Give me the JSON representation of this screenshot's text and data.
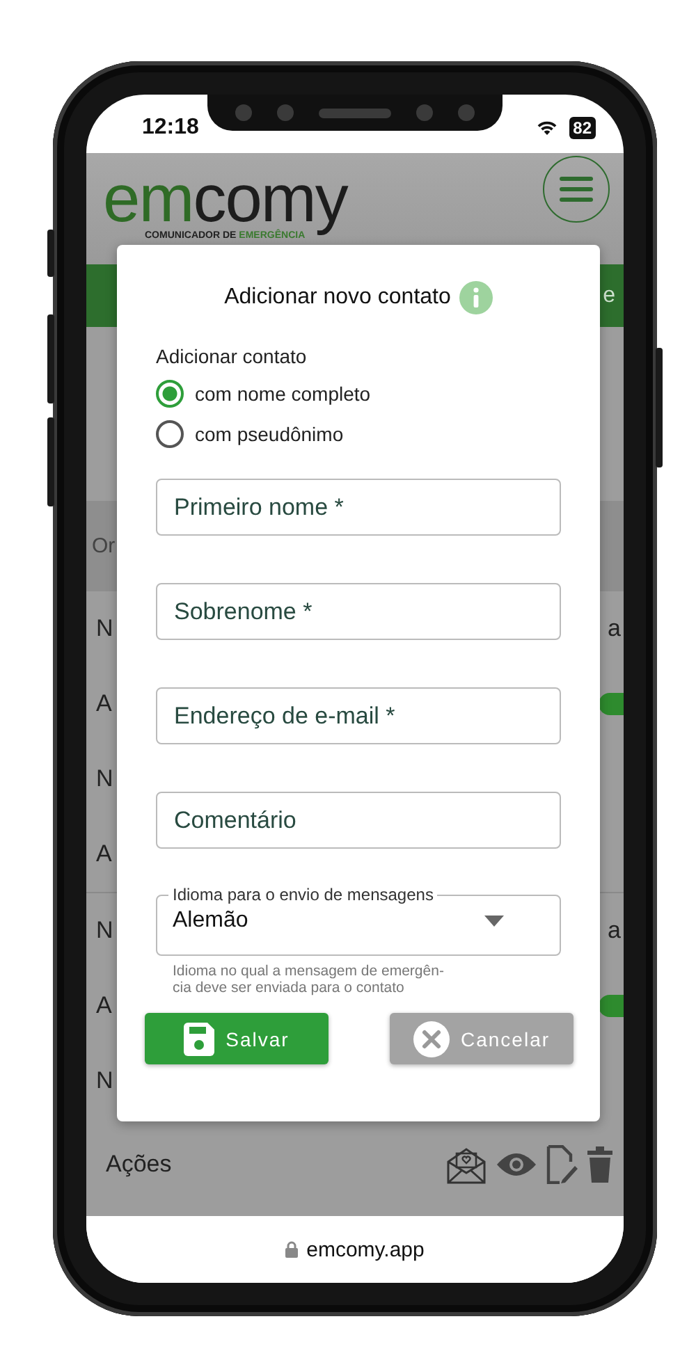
{
  "status_bar": {
    "time": "12:18",
    "battery": "82"
  },
  "header": {
    "logo": {
      "highlight": "em",
      "rest": "comy",
      "tagline": "COMUNICADOR DE",
      "tagline_highlight": "EMERGÊNCIA"
    }
  },
  "green_bar": {
    "text": "e"
  },
  "list_header": {
    "text": "Or"
  },
  "rows": [
    {
      "label": "N",
      "trailing": "a",
      "kind": "text"
    },
    {
      "label": "A",
      "kind": "toggle",
      "on": true
    },
    {
      "label": "N",
      "kind": "plain"
    },
    {
      "label": "A",
      "kind": "plain"
    },
    {
      "label": "N",
      "trailing": "a",
      "kind": "text"
    },
    {
      "label": "A",
      "kind": "toggle",
      "on": true
    },
    {
      "label": "N",
      "kind": "plain"
    }
  ],
  "actions_row": {
    "label": "Ações"
  },
  "dialog": {
    "title": "Adicionar novo contato",
    "group_label": "Adicionar contato",
    "options": [
      {
        "label": "com nome completo",
        "selected": true
      },
      {
        "label": "com pseudônimo",
        "selected": false
      }
    ],
    "fields": [
      {
        "placeholder": "Primeiro nome *"
      },
      {
        "placeholder": "Sobrenome *"
      },
      {
        "placeholder": "Endereço de e-mail *"
      },
      {
        "placeholder": "Comentário"
      }
    ],
    "language": {
      "label": "Idioma para o envio de mensagens",
      "value": "Alemão",
      "helper": "Idioma no qual a mensagem de emergên-\ncia deve ser enviada para o contato"
    },
    "buttons": [
      {
        "label": "Salvar",
        "kind": "save"
      },
      {
        "label": "Cancelar",
        "kind": "cancel"
      }
    ]
  },
  "url_bar": {
    "url": "emcomy.app"
  }
}
